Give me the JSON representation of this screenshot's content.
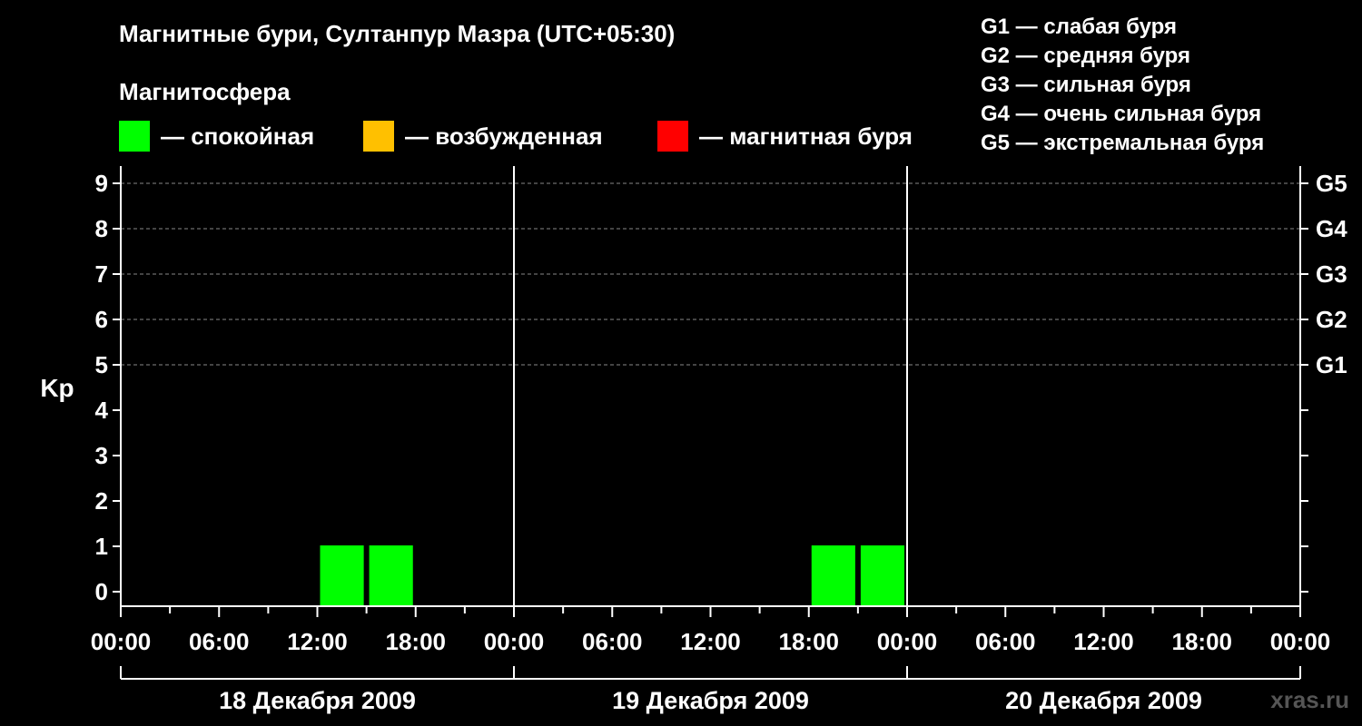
{
  "title": "Магнитные бури, Султанпур Мазра (UTC+05:30)",
  "magnetosphere_label": "Магнитосфера",
  "legend": [
    {
      "color": "#00ff00",
      "label": "— спокойная"
    },
    {
      "color": "#ffc000",
      "label": "— возбужденная"
    },
    {
      "color": "#ff0000",
      "label": "— магнитная буря"
    }
  ],
  "g_scale": [
    "G1 — слабая буря",
    "G2 — средняя буря",
    "G3 — сильная буря",
    "G4 — очень сильная буря",
    "G5 — экстремальная буря"
  ],
  "credit": "xras.ru",
  "chart_data": {
    "type": "bar",
    "ylabel": "Kp",
    "ylim": [
      0,
      9
    ],
    "yticks": [
      "0",
      "1",
      "2",
      "3",
      "4",
      "5",
      "6",
      "7",
      "8",
      "9"
    ],
    "right_ticks": [
      {
        "kp": 5,
        "label": "G1"
      },
      {
        "kp": 6,
        "label": "G2"
      },
      {
        "kp": 7,
        "label": "G3"
      },
      {
        "kp": 8,
        "label": "G4"
      },
      {
        "kp": 9,
        "label": "G5"
      }
    ],
    "x_tick_labels": [
      "00:00",
      "06:00",
      "12:00",
      "18:00",
      "00:00",
      "06:00",
      "12:00",
      "18:00",
      "00:00",
      "06:00",
      "12:00",
      "18:00",
      "00:00"
    ],
    "days": [
      "18 Декабря 2009",
      "19 Декабря 2009",
      "20 Декабря 2009"
    ],
    "bars": [
      {
        "day": "18 Декабря 2009",
        "start": "12:00",
        "end": "15:00",
        "kp": 1,
        "level": "спокойная",
        "color": "#00ff00"
      },
      {
        "day": "18 Декабря 2009",
        "start": "15:00",
        "end": "18:00",
        "kp": 1,
        "level": "спокойная",
        "color": "#00ff00"
      },
      {
        "day": "19 Декабря 2009",
        "start": "18:00",
        "end": "21:00",
        "kp": 1,
        "level": "спокойная",
        "color": "#00ff00"
      },
      {
        "day": "19 Декабря 2009",
        "start": "21:00",
        "end": "24:00",
        "kp": 1,
        "level": "спокойная",
        "color": "#00ff00"
      }
    ],
    "grid": "dashed horizontal at Kp 5–9"
  }
}
